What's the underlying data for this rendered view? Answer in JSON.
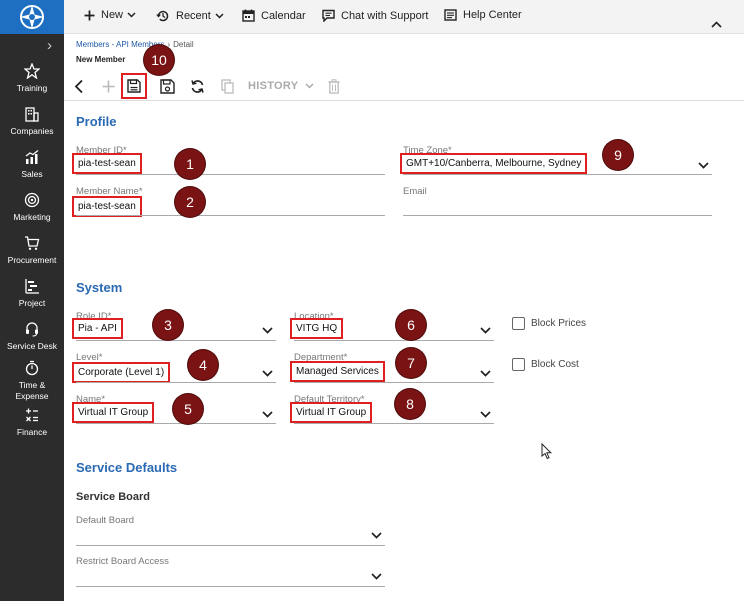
{
  "topbar": {
    "new_label": "New",
    "recent_label": "Recent",
    "calendar_label": "Calendar",
    "chat_label": "Chat with Support",
    "help_label": "Help Center"
  },
  "sidebar": {
    "items": [
      {
        "label": "Training",
        "icon": "star-icon"
      },
      {
        "label": "Companies",
        "icon": "building-icon"
      },
      {
        "label": "Sales",
        "icon": "chart-icon"
      },
      {
        "label": "Marketing",
        "icon": "target-icon"
      },
      {
        "label": "Procurement",
        "icon": "cart-icon"
      },
      {
        "label": "Project",
        "icon": "gantt-icon"
      },
      {
        "label": "Service Desk",
        "icon": "headset-icon"
      },
      {
        "label": "Time &",
        "label2": "Expense",
        "icon": "timer-icon"
      },
      {
        "label": "Finance",
        "icon": "calculator-icon"
      }
    ]
  },
  "breadcrumb": {
    "parent": "Members - API Members",
    "current": "Detail"
  },
  "page_title": "New Member",
  "toolbar": {
    "history_label": "HISTORY"
  },
  "profile": {
    "title": "Profile",
    "member_id": {
      "label": "Member ID*",
      "value": "pia-test-sean"
    },
    "member_name": {
      "label": "Member Name*",
      "value": "pia-test-sean"
    },
    "time_zone": {
      "label": "Time Zone*",
      "value": "GMT+10/Canberra, Melbourne, Sydney"
    },
    "email": {
      "label": "Email",
      "value": ""
    }
  },
  "system": {
    "title": "System",
    "role_id": {
      "label": "Role ID*",
      "value": "Pia - API"
    },
    "level": {
      "label": "Level*",
      "value": "Corporate (Level 1)"
    },
    "name": {
      "label": "Name*",
      "value": "Virtual IT Group"
    },
    "location": {
      "label": "Location*",
      "value": "VITG HQ"
    },
    "department": {
      "label": "Department*",
      "value": "Managed Services"
    },
    "default_territory": {
      "label": "Default Territory*",
      "value": "Virtual IT Group"
    },
    "block_prices": {
      "label": "Block Prices",
      "checked": false
    },
    "block_cost": {
      "label": "Block Cost",
      "checked": false
    }
  },
  "service_defaults": {
    "title": "Service Defaults",
    "board_heading": "Service Board",
    "default_board": {
      "label": "Default Board",
      "value": ""
    },
    "restrict_board_access": {
      "label": "Restrict Board Access",
      "value": ""
    }
  },
  "annotations": [
    "1",
    "2",
    "3",
    "4",
    "5",
    "6",
    "7",
    "8",
    "9",
    "10"
  ],
  "colors": {
    "accent": "#2a6ab3",
    "sidebar": "#2c2c2c",
    "logo_bg": "#1e6fc2",
    "highlight": "#e02020",
    "badge": "#7a1313"
  }
}
